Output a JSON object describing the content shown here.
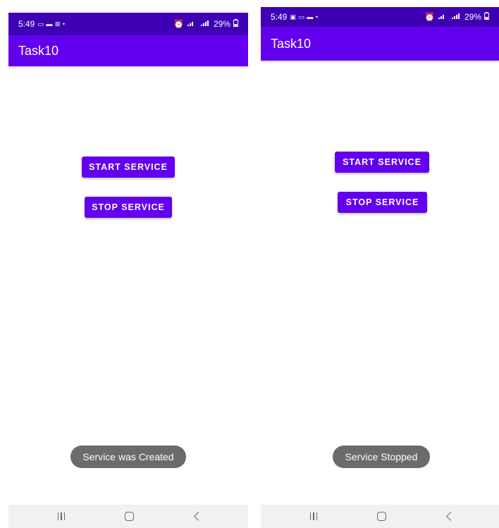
{
  "left_screen": {
    "status_time": "5:49",
    "status_indicators": "▭ ▬ ⊠ •",
    "battery": "29%",
    "app_title": "Task10",
    "start_button": "START SERVICE",
    "stop_button": "STOP SERVICE",
    "toast": "Service was Created"
  },
  "right_screen": {
    "status_time": "5:49",
    "status_indicators": "▣ ▭ ▬ •",
    "battery": "29%",
    "app_title": "Task10",
    "start_button": "START SERVICE",
    "stop_button": "STOP SERVICE",
    "toast": "Service Stopped"
  },
  "colors": {
    "status_bar": "#3f00b5",
    "app_bar": "#6200ee",
    "button": "#6200ee",
    "toast": "#6b6b6b",
    "nav_bar": "#f1f1f1"
  }
}
